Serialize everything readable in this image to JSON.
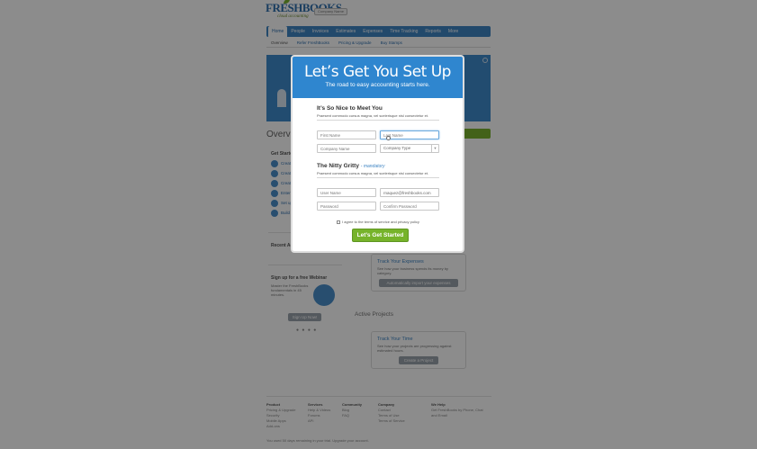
{
  "page": {
    "logo_text": "FRESHBOOKS",
    "logo_tagline": "cloud accounting",
    "company_button": "Company Name",
    "main_nav": [
      "Home",
      "People",
      "Invoices",
      "Estimates",
      "Expenses",
      "Time Tracking",
      "Reports",
      "More"
    ],
    "sub_nav": [
      "Overview",
      "Refer FreshBooks",
      "Pricing & Upgrade",
      "Buy Stamps"
    ],
    "overview_title": "Overview",
    "get_started_title": "Get Started",
    "get_started_items": [
      "Create",
      "Create",
      "Create",
      "Enter",
      "Set up",
      "Build"
    ],
    "recent_title": "Recent Activity",
    "webinar": {
      "title": "Sign up for a free Webinar",
      "desc": "Master the FreshBooks fundamentals in 45 minutes.",
      "button": "Sign Up Now!"
    },
    "expenses_card": {
      "title": "Track Your Expenses",
      "desc": "See how your business spends its money by category.",
      "button": "Automatically import your expenses"
    },
    "project_section_title": "Active Projects",
    "time_card": {
      "title": "Track Your Time",
      "desc": "See how your projects are progressing against estimated hours.",
      "button": "Create a Project"
    },
    "footer_cols": [
      {
        "head": "Product",
        "items": [
          "Pricing & Upgrade",
          "Security",
          "Mobile Apps",
          "Add-ons"
        ]
      },
      {
        "head": "Services",
        "items": [
          "Help & Videos",
          "Forums",
          "API"
        ]
      },
      {
        "head": "Community",
        "items": [
          "Blog",
          "FAQ"
        ]
      },
      {
        "head": "Company",
        "items": [
          "Contact",
          "Terms of Use",
          "Terms of Service"
        ]
      },
      {
        "head": "We Help",
        "items": [
          "Get FreshBooks by Phone, Chat",
          "and Email"
        ]
      }
    ],
    "copyright": "You used 50 days remaining in your trial. Upgrade your account."
  },
  "modal": {
    "title": "Let’s Get You Set Up",
    "subtitle": "The road to easy accounting starts here.",
    "section1": {
      "heading": "It’s So Nice to Meet You",
      "desc": "Praesent commodo cursus magna, vel scelerisque nisl consectetur et."
    },
    "first_name_placeholder": "First Name",
    "last_name_placeholder": "Last Name",
    "company_name_placeholder": "Company Name",
    "company_type_label": "Company Type",
    "section2": {
      "heading": "The Nitty Gritty",
      "mandatory": "- mandatory",
      "desc": "Praesent commodo cursus magna, vel scelerisque nisl consectetur et."
    },
    "username_placeholder": "User Name",
    "email_value": "rnaquez@freshbooks.com",
    "password_placeholder": "Password",
    "confirm_password_placeholder": "Confirm Password",
    "terms_text": "I agree to the terms of service and privacy policy",
    "submit_label": "Let’s Get Started"
  },
  "colors": {
    "header_blue": "#2f86cf",
    "nav_blue": "#3f85c3",
    "cta_green": "#76b32a",
    "overlay": "rgba(0,0,0,0.45)"
  }
}
